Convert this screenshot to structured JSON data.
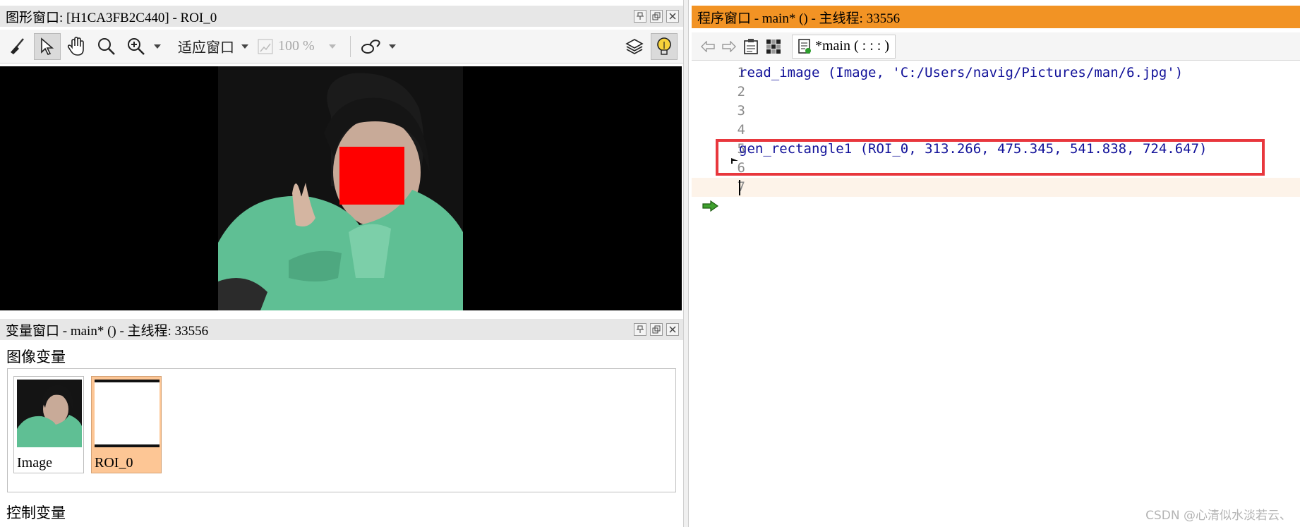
{
  "graphics_window": {
    "title": "图形窗口: [H1CA3FB2C440] - ROI_0",
    "toolbar": {
      "fit_label": "适应窗口",
      "zoom_label": "100 %"
    },
    "roi_color": "#ff0000"
  },
  "variable_window": {
    "title": "变量窗口 - main* () - 主线程: 33556",
    "iconic_section": "图像变量",
    "control_section": "控制变量",
    "items": [
      {
        "label": "Image"
      },
      {
        "label": "ROI_0"
      }
    ],
    "selected_color": "#fdc695"
  },
  "program_window": {
    "title": "程序窗口 - main* () - 主线程: 33556",
    "title_color": "#f29324",
    "procedure_tab": "*main ( : : : )",
    "lines": [
      {
        "num": "1",
        "code": "read_image (Image, 'C:/Users/navig/Pictures/man/6.jpg')"
      },
      {
        "num": "2",
        "code": ""
      },
      {
        "num": "3",
        "code": ""
      },
      {
        "num": "4",
        "code": ""
      },
      {
        "num": "5",
        "code": "gen_rectangle1 (ROI_0, 313.266, 475.345, 541.838, 724.647)"
      },
      {
        "num": "6",
        "code": ""
      },
      {
        "num": "7",
        "code": ""
      }
    ],
    "highlight_color": "#e8373d"
  },
  "watermark": "CSDN @心清似水淡若云、"
}
